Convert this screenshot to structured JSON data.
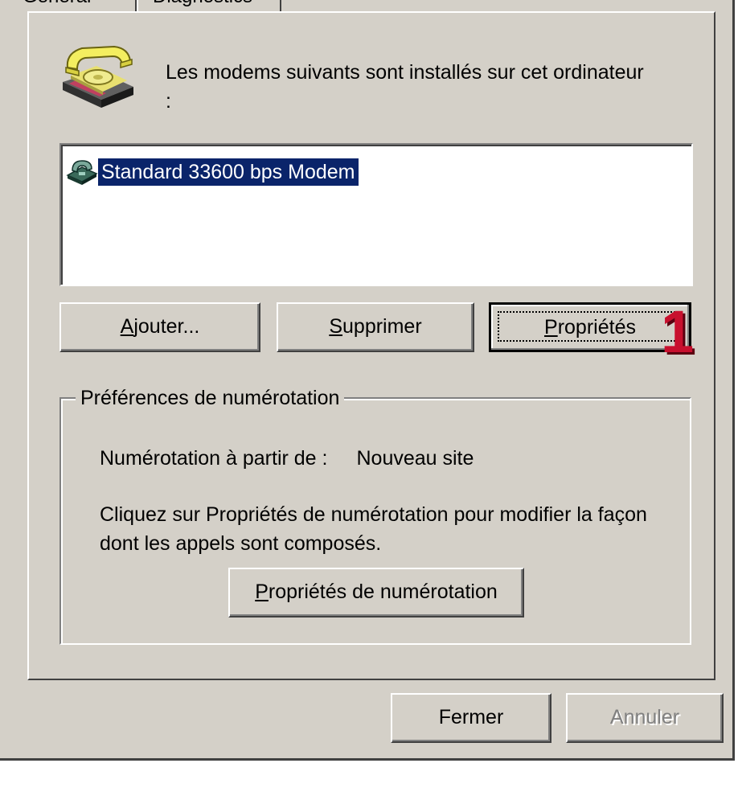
{
  "tabs": [
    {
      "label": "Général"
    },
    {
      "label": "Diagnostics"
    }
  ],
  "intro_text": "Les modems suivants sont installés sur cet ordinateur :",
  "modem_list": {
    "items": [
      {
        "label": "Standard 33600 bps Modem",
        "selected": true
      }
    ]
  },
  "buttons": {
    "add": {
      "pre": "",
      "accel": "A",
      "post": "jouter..."
    },
    "remove": {
      "pre": "",
      "accel": "S",
      "post": "upprimer"
    },
    "properties": {
      "pre": "",
      "accel": "P",
      "post": "ropriétés"
    }
  },
  "dialing_group": {
    "legend": "Préférences de numérotation",
    "dial_from_label": "Numérotation à partir de :",
    "dial_from_value": "Nouveau site",
    "help_text": "Cliquez sur Propriétés de numérotation pour modifier la façon dont les appels sont composés.",
    "button": {
      "pre": "",
      "accel": "P",
      "post": "ropriétés de numérotation"
    }
  },
  "footer": {
    "close_label": "Fermer",
    "cancel_label": "Annuler"
  },
  "annotation_badge": "1",
  "colors": {
    "face": "#d4d0c8",
    "selection": "#0a246a",
    "badge": "#c8102e"
  }
}
